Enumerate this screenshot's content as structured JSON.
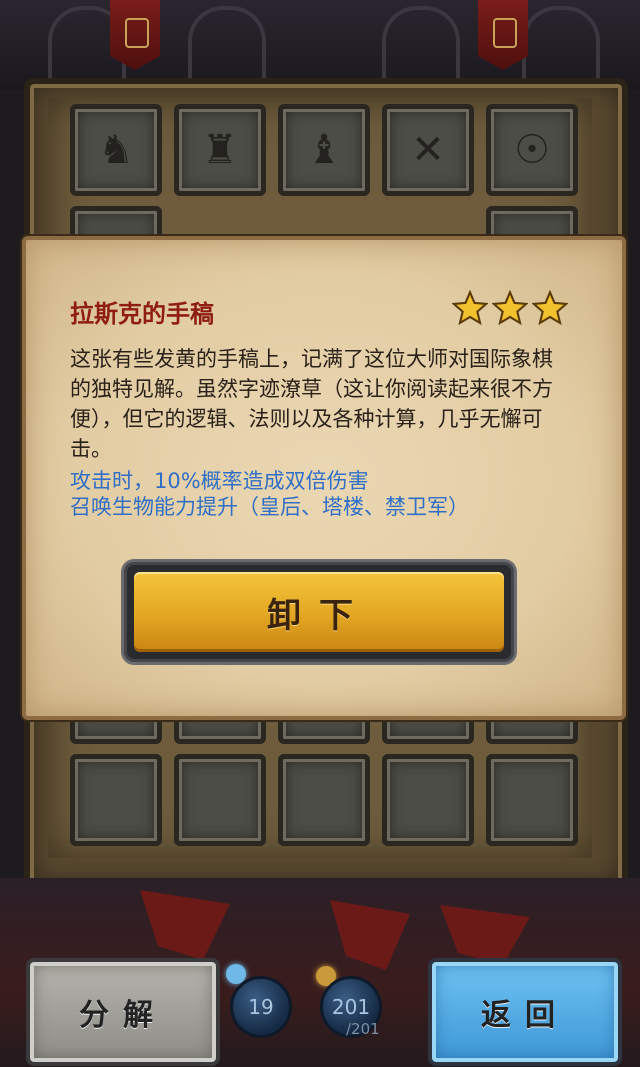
{
  "item_dialog": {
    "title": "拉斯克的手稿",
    "star_count": 3,
    "description": "这张有些发黄的手稿上，记满了这位大师对国际象棋的独特见解。虽然字迹潦草（这让你阅读起来很不方便），但它的逻辑、法则以及各种计算，几乎无懈可击。",
    "effects": [
      "攻击时，10%概率造成双倍伤害",
      "召唤生物能力提升（皇后、塔楼、禁卫军）"
    ],
    "unequip_label": "卸下"
  },
  "bottom_bar": {
    "disassemble_label": "分解",
    "back_label": "返回",
    "resource_count": "19",
    "capacity_current": "201",
    "capacity_max": "/201"
  },
  "colors": {
    "title": "#8f1d12",
    "effect_text": "#2f6fc6",
    "unequip_button": "#e3a622",
    "back_button": "#3d96d6"
  }
}
